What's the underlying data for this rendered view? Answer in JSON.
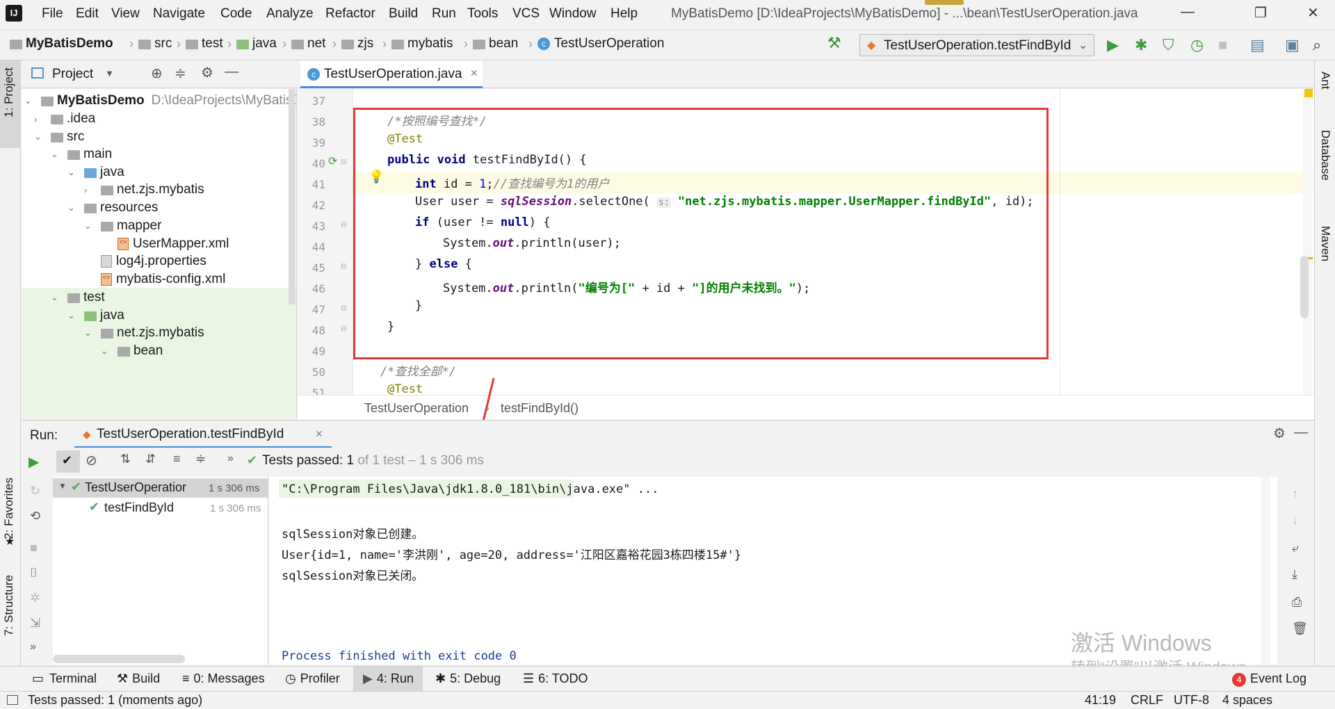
{
  "window": {
    "title": "MyBatisDemo [D:\\IdeaProjects\\MyBatisDemo] - ...\\bean\\TestUserOperation.java"
  },
  "menu": [
    "File",
    "Edit",
    "View",
    "Navigate",
    "Code",
    "Analyze",
    "Refactor",
    "Build",
    "Run",
    "Tools",
    "VCS",
    "Window",
    "Help"
  ],
  "breadcrumbs": [
    "MyBatisDemo",
    "src",
    "test",
    "java",
    "net",
    "zjs",
    "mybatis",
    "bean",
    "TestUserOperation"
  ],
  "run_config": "TestUserOperation.testFindById",
  "project_panel": {
    "title": "Project"
  },
  "project_tree": [
    {
      "label": "MyBatisDemo",
      "suffix": "D:\\IdeaProjects\\MyBatisDem"
    },
    {
      "label": ".idea"
    },
    {
      "label": "src"
    },
    {
      "label": "main"
    },
    {
      "label": "java"
    },
    {
      "label": "net.zjs.mybatis"
    },
    {
      "label": "resources"
    },
    {
      "label": "mapper"
    },
    {
      "label": "UserMapper.xml"
    },
    {
      "label": "log4j.properties"
    },
    {
      "label": "mybatis-config.xml"
    },
    {
      "label": "test"
    },
    {
      "label": "java"
    },
    {
      "label": "net.zjs.mybatis"
    },
    {
      "label": "bean"
    }
  ],
  "editor_tab": "TestUserOperation.java",
  "code_lines": {
    "numbers": [
      "37",
      "38",
      "39",
      "40",
      "41",
      "42",
      "43",
      "44",
      "45",
      "46",
      "47",
      "48",
      "49",
      "50",
      "51"
    ],
    "l38": "/*按照编号查找*/",
    "l39": "@Test",
    "l40_kw1": "public",
    "l40_kw2": "void",
    "l40_rest": " testFindById() {",
    "l41_kw": "int",
    "l41_a": " id = ",
    "l41_num": "1",
    "l41_b": ";",
    "l41_cm": "//查找编号为1的用户",
    "l42_a": "User user = ",
    "l42_fld": "sqlSession",
    "l42_b": ".selectOne( ",
    "l42_hint": "s:",
    "l42_str": " \"net.zjs.mybatis.mapper.UserMapper.findById\"",
    "l42_c": ", id);",
    "l43_kw": "if",
    "l43_a": " (user != ",
    "l43_kw2": "null",
    "l43_b": ") {",
    "l44_a": "System.",
    "l44_fld": "out",
    "l44_b": ".println(user);",
    "l45_a": "} ",
    "l45_kw": "else",
    "l45_b": " {",
    "l46_a": "System.",
    "l46_fld": "out",
    "l46_b": ".println(",
    "l46_str1": "\"编号为[\"",
    "l46_c": " + id + ",
    "l46_str2": "\"]的用户未找到。\"",
    "l46_d": ");",
    "l47": "}",
    "l48": "}",
    "l50": "/*查找全部*/",
    "l51": "@Test"
  },
  "editor_breadcrumb": [
    "TestUserOperation",
    "testFindById()"
  ],
  "run_panel": {
    "label": "Run:",
    "tab": "TestUserOperation.testFindById",
    "status_prefix": "Tests passed:",
    "status_count": "1",
    "status_suffix": "of 1 test – 1 s 306 ms"
  },
  "test_tree": [
    {
      "name": "TestUserOperatior",
      "time": "1 s 306 ms"
    },
    {
      "name": "testFindById",
      "time": "1 s 306 ms"
    }
  ],
  "console": {
    "cmd": "\"C:\\Program Files\\Java\\jdk1.8.0_181\\bin\\java.exe\" ...",
    "line1": "sqlSession对象已创建。",
    "line2": "User{id=1, name='李洪刚', age=20, address='江阳区嘉裕花园3栋四楼15#'}",
    "line3": "sqlSession对象已关闭。",
    "exit": "Process finished with exit code 0"
  },
  "left_tool_tabs": [
    "1: Project",
    "2: Favorites",
    "7: Structure"
  ],
  "right_tool_tabs": [
    "Ant",
    "Database",
    "Maven"
  ],
  "bottom_tabs": [
    "Terminal",
    "Build",
    "0: Messages",
    "Profiler",
    "4: Run",
    "5: Debug",
    "6: TODO"
  ],
  "event_log": {
    "label": "Event Log",
    "count": "4"
  },
  "status": {
    "message": "Tests passed: 1 (moments ago)",
    "position": "41:19",
    "line_sep": "CRLF",
    "encoding": "UTF-8",
    "indent": "4 spaces"
  },
  "watermark": {
    "line1": "激活 Windows",
    "line2": "转到“设置”以激活 Windows。"
  },
  "colors": {
    "accent_red": "#e53935",
    "pass_green": "#59a869",
    "keyword": "#000080",
    "string": "#008000"
  }
}
